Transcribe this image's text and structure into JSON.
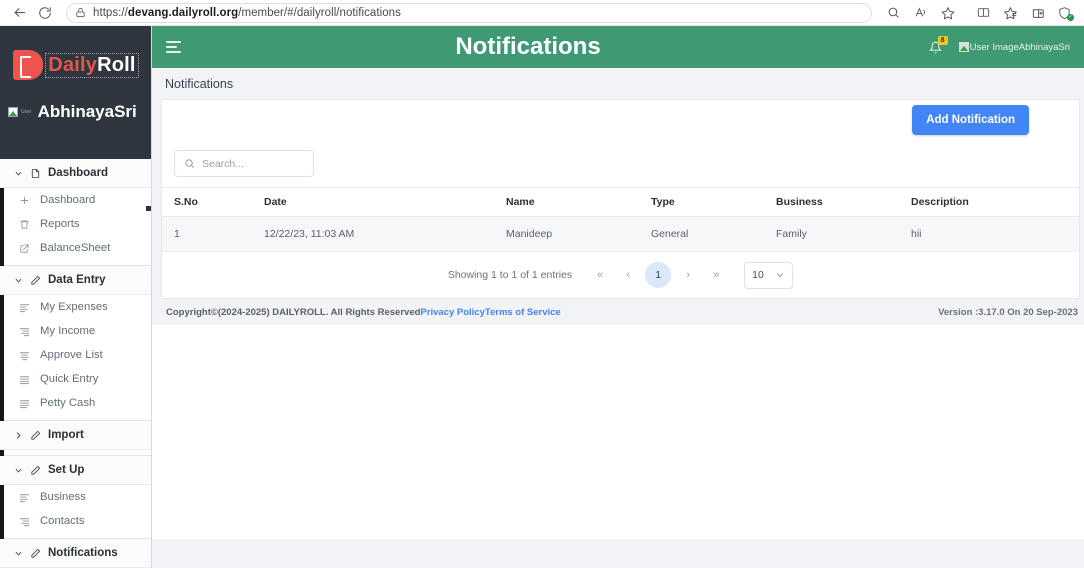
{
  "browser": {
    "url_prefix": "https://",
    "url_domain": "devang.dailyroll.org",
    "url_path": "/member/#/dailyroll/notifications",
    "back_icon": "back-arrow-icon",
    "reload_icon": "reload-icon",
    "lock_icon": "lock-icon",
    "icons": [
      "search-icon",
      "read-aloud-icon",
      "favorite-star-icon",
      "reading-view-icon",
      "collections-icon",
      "browser-essentials-icon",
      "shield-check-icon"
    ]
  },
  "sidebar": {
    "logo_mark": "D",
    "logo_text_a": "Daily",
    "logo_text_b": "Roll",
    "user_alt": "User",
    "user_name": "AbhinayaSri",
    "groups": [
      {
        "label": "Dashboard",
        "icon": "file-icon",
        "chevron": "chevron-down-icon",
        "expanded": true,
        "items": [
          {
            "label": "Dashboard",
            "icon": "plus-icon"
          },
          {
            "label": "Reports",
            "icon": "trash-icon"
          },
          {
            "label": "BalanceSheet",
            "icon": "external-link-icon"
          }
        ]
      },
      {
        "label": "Data Entry",
        "icon": "pencil-icon",
        "chevron": "chevron-down-icon",
        "expanded": true,
        "items": [
          {
            "label": "My Expenses",
            "icon": "align-left-icon"
          },
          {
            "label": "My Income",
            "icon": "align-right-icon"
          },
          {
            "label": "Approve List",
            "icon": "align-center-icon"
          },
          {
            "label": "Quick Entry",
            "icon": "justify-icon"
          },
          {
            "label": "Petty Cash",
            "icon": "list-icon"
          }
        ]
      },
      {
        "label": "Import",
        "icon": "pencil-icon",
        "chevron": "chevron-right-icon",
        "expanded": false,
        "items": []
      },
      {
        "label": "Set Up",
        "icon": "pencil-icon",
        "chevron": "chevron-down-icon",
        "expanded": true,
        "items": [
          {
            "label": "Business",
            "icon": "align-left-icon"
          },
          {
            "label": "Contacts",
            "icon": "align-right-icon"
          }
        ]
      },
      {
        "label": "Notifications",
        "icon": "pencil-icon",
        "chevron": "chevron-down-icon",
        "expanded": true,
        "items": []
      }
    ]
  },
  "topbar": {
    "menu_icon": "hamburger-menu-icon",
    "title": "Notifications",
    "bell_icon": "bell-icon",
    "bell_badge": "8",
    "avatar_alt": "User Image",
    "user_name": "AbhinayaSri",
    "bg_color": "#3f9a73"
  },
  "page": {
    "breadcrumb": "Notifications",
    "add_button": "Add Notification",
    "add_button_color": "#4285f4"
  },
  "search": {
    "icon": "search-icon",
    "placeholder": "Search...",
    "value": ""
  },
  "table": {
    "columns": [
      "S.No",
      "Date",
      "Name",
      "Type",
      "Business",
      "Description"
    ],
    "rows": [
      {
        "sno": "1",
        "date": "12/22/23, 11:03 AM",
        "name": "Manideep",
        "type": "General",
        "business": "Family",
        "description": "hii"
      }
    ]
  },
  "pagination": {
    "info": "Showing 1 to 1 of 1 entries",
    "first": "«",
    "prev": "‹",
    "current_page": "1",
    "next": "›",
    "last": "»",
    "page_size": "10",
    "chevron_icon": "chevron-down-icon"
  },
  "footer": {
    "copyright": "Copyright©(2024-2025) DAILYROLL. All Rights Reserved",
    "privacy_link": "Privacy Policy",
    "terms_link": "Terms of Service",
    "version": "Version :3.17.0 On 20 Sep-2023"
  }
}
